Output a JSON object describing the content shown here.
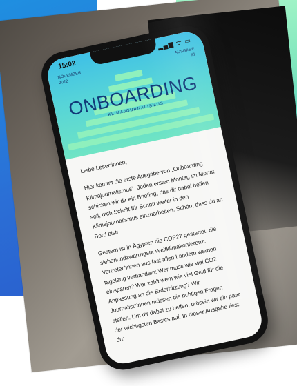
{
  "phone": {
    "status_time": "15:02",
    "status_icons": "▂▄▆ ᯤ ▭",
    "header": {
      "date_line1": "November",
      "date_line2": "2022",
      "issue_line1": "Ausgabe",
      "issue_line2": "#1",
      "title": "ONBOARDING",
      "subtitle": "KLIMAJOURNALISMUS"
    },
    "greeting": "Liebe Leser:innen,",
    "paragraph1": "Hier kommt die erste Ausgabe von „Onboarding Klimajournalismus\". Jeden ersten Montag im Monat schicken wir dir ein Briefing, das dir dabei helfen soll, dich Schritt für Schritt weiter in den Klimajournalismus einzuarbeiten. Schön, dass du an Bord bist!",
    "paragraph2": "Gestern ist in Ägypten die COP27 gestartet, die siebenundzwanzigste Weltklimakonferenz. Vertreter*innen aus fast allen Ländern werden tagelang verhandeln: Wer muss wie viel CO2 einsparen? Wer zahlt wem wie viel Geld für die Anpassung an die Erderhitzung? Wir Journalist*innen müssen die richtigen Fragen stellen. Um dir dabei zu helfen, drösein wir ein paar der wichtigsten Basics auf. In dieser Ausgabe liest du:"
  },
  "colors": {
    "accent_blue": "#2b6fd6",
    "accent_mint": "#8ff0bd",
    "title_navy": "#123a78"
  }
}
